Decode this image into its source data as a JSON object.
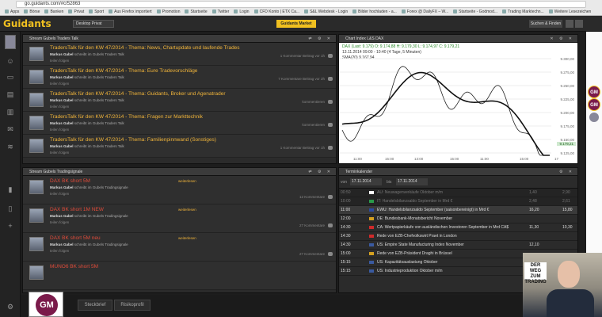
{
  "browser": {
    "url": "go.guidants.com/#c/52863",
    "bookmarks": [
      "Apps",
      "Börse",
      "Banken",
      "Privat",
      "Sport",
      "Aus Firefox importiert",
      "Promotion",
      "Startseite",
      "Twitter",
      "Login",
      "CFD Konto | ETX Ca...",
      "S&L Webdesk - Login",
      "Bilder hochladen - a...",
      "Forex @ DailyFX – W...",
      "Startseite - Godmod...",
      "Trading Marktechn...",
      "Weitere Lesezeichen"
    ]
  },
  "app": {
    "logo": "Guidants",
    "desktop": "Desktop Privat",
    "guidants_market": "Guidants Market",
    "search": "Suchen & Finden"
  },
  "stream_talk": {
    "title": "Stream Gubels Traders Talk",
    "items": [
      {
        "title": "TradersTalk für den KW 47/2014 - Thema: News, Chartupdate und laufende Trades",
        "author": "Markus Gabel",
        "action": "schreibt im",
        "stream": "Gubels Traders Talk",
        "meta": "teilen  folgen",
        "stats": "1 Kommentar  Beitrag vor 1h"
      },
      {
        "title": "TradersTalk für den KW 47/2014 - Thema: Eure Tradevorschläge",
        "author": "Markus Gabel",
        "action": "schreibt im",
        "stream": "Gubels Traders Talk",
        "meta": "teilen  folgen",
        "stats": "7 Kommentare  Beitrag vor 2h"
      },
      {
        "title": "TradersTalk für den KW 47/2014 - Thema: Guidants, Broker und Agenatrader",
        "author": "Markus Gabel",
        "action": "schreibt im",
        "stream": "Gubels Traders Talk",
        "meta": "teilen  folgen",
        "stats": "kommentieren"
      },
      {
        "title": "TradersTalk für den KW 47/2014 - Thema: Fragen zur Markttechnik",
        "author": "Markus Gabel",
        "action": "schreibt im",
        "stream": "Gubels Traders Talk",
        "meta": "teilen  folgen",
        "stats": "kommentieren"
      },
      {
        "title": "TradersTalk für den KW 47/2014 - Thema: Familienpinnwand (Sonstiges)",
        "author": "Markus Gabel",
        "action": "schreibt im",
        "stream": "Gubels Traders Talk",
        "meta": "teilen  folgen",
        "stats": "1 Kommentar  Beitrag vor 1h"
      }
    ]
  },
  "stream_trading": {
    "title": "Stream Gubels Tradingsignale",
    "more": "weiterlesen",
    "items": [
      {
        "title": "DAX BK short 5M",
        "author": "Markus Gabel",
        "action": "schreibt im",
        "stream": "Gubels Tradingsignale",
        "meta": "teilen  folgen",
        "stats": "12 Kommentare"
      },
      {
        "title": "DAX BK short 1M NEW",
        "author": "Markus Gabel",
        "action": "schreibt im",
        "stream": "Gubels Tradingsignale",
        "meta": "teilen  folgen",
        "stats": "27 Kommentare"
      },
      {
        "title": "DAX BK short 5M neu",
        "author": "Markus Gabel",
        "action": "schreibt im",
        "stream": "Gubels Tradingsignale",
        "meta": "teilen  folgen",
        "stats": "27 Kommentare"
      },
      {
        "title": "MUNO6 BK short 5M",
        "author": "",
        "action": "",
        "stream": "",
        "meta": "",
        "stats": ""
      }
    ]
  },
  "chart": {
    "title": "Chart Index L&S DAX",
    "series_label": "DAX (Last: 9.179) O: 9.174,88  H: 9.179,30  L: 9.174,97  C: 9.179,21",
    "period": "13.11.2014 09:00 - 10:40 (4 Tage, 5 Minuten)",
    "sma_label": "SMA(20)  9.167,94",
    "price_tag": "9.179,21",
    "y_ticks": [
      "9.300,00",
      "9.275,00",
      "9.250,00",
      "9.225,00",
      "9.200,00",
      "9.175,00",
      "9.150,00",
      "9.125,00"
    ],
    "x_ticks": [
      "11:00",
      "15:00",
      "13:00",
      "15:00",
      "11:00",
      "15:00",
      "17"
    ]
  },
  "calendar": {
    "title": "Terminkalender",
    "from_label": "von",
    "from_date": "17.11.2014",
    "to_label": "bis",
    "to_date": "17.11.2014",
    "rows": [
      {
        "time": "00:50",
        "country": "JP",
        "text": "AU: Neuwagenverkäufe Oktober m/m",
        "v1": "1,40",
        "v2": "2,90",
        "dim": true,
        "hl": false
      },
      {
        "time": "10:00",
        "country": "IT",
        "text": "IT: Handelsbilanzsaldo September in Mrd €",
        "v1": "2,48",
        "v2": "2,61",
        "dim": true,
        "hl": false
      },
      {
        "time": "11:00",
        "country": "EU",
        "text": "EWU: Handelsbilanzsaldo September (saisonbereinigt) in Mrd €",
        "v1": "16,20",
        "v2": "15,80",
        "dim": false,
        "hl": true
      },
      {
        "time": "12:00",
        "country": "DE",
        "text": "DE: Bundesbank-Monatsbericht November",
        "v1": "",
        "v2": "",
        "dim": false,
        "hl": false
      },
      {
        "time": "14:30",
        "country": "CA",
        "text": "CA: Wertpapierkäufe von ausländischen Investoren September in Mrd CA$",
        "v1": "11,30",
        "v2": "10,30",
        "dim": false,
        "hl": false
      },
      {
        "time": "14:30",
        "country": "CA",
        "text": "Rede von EZB-Chefvolkswirt Praet in London",
        "v1": "",
        "v2": "",
        "dim": false,
        "hl": false
      },
      {
        "time": "14:30",
        "country": "US",
        "text": "US: Empire State Manufacturing Index November",
        "v1": "12,10",
        "v2": "",
        "dim": false,
        "hl": false
      },
      {
        "time": "15:00",
        "country": "DE",
        "text": "Rede von EZB-Präsident Draghi in Brüssel",
        "v1": "",
        "v2": "",
        "dim": false,
        "hl": false
      },
      {
        "time": "15:15",
        "country": "US",
        "text": "US: Kapazitätsauslastung Oktober",
        "v1": "",
        "v2": "",
        "dim": false,
        "hl": false
      },
      {
        "time": "15:15",
        "country": "US",
        "text": "US: Industrieproduktion Oktober m/m",
        "v1": "",
        "v2": "",
        "dim": false,
        "hl": false
      }
    ]
  },
  "bottom_tabs": [
    "Steckbrief",
    "Risikoprofil"
  ],
  "gm_logo": "GM",
  "webcam_sign": "DER WEG ZUM TRADING"
}
